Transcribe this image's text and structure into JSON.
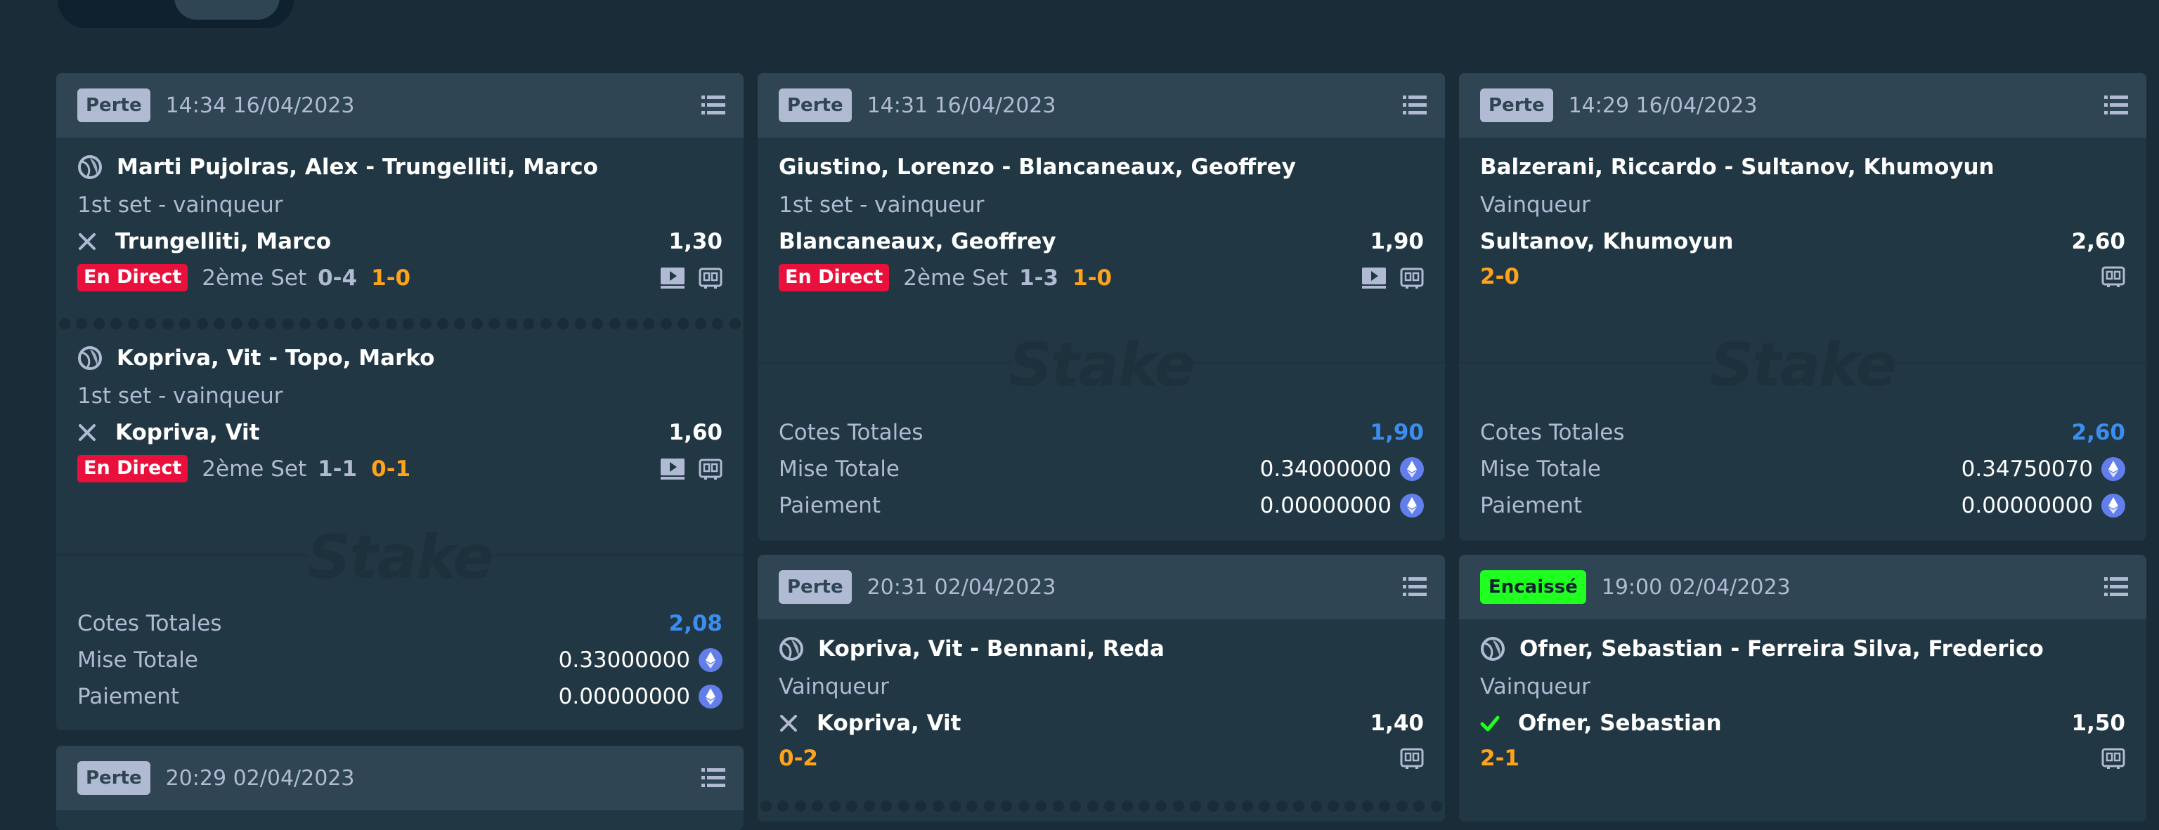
{
  "bets": [
    {
      "status": "Perte",
      "time": "14:34 16/04/2023",
      "legs": [
        {
          "match": "Marti Pujolras, Alex - Trungelliti, Marco",
          "market": "1st set - vainqueur",
          "selection": "Trungelliti, Marco",
          "odds": "1,30",
          "result_icon": "cross-icon",
          "live": "En Direct",
          "set": "2ème Set",
          "score_a": "0-4",
          "score_b": "1-0"
        },
        {
          "match": "Kopriva, Vit - Topo, Marko",
          "market": "1st set - vainqueur",
          "selection": "Kopriva, Vit",
          "odds": "1,60",
          "result_icon": "cross-icon",
          "live": "En Direct",
          "set": "2ème Set",
          "score_a": "1-1",
          "score_b": "0-1"
        }
      ],
      "watermark": "Stake",
      "totals": {
        "odds_label": "Cotes Totales",
        "odds": "2,08",
        "stake_label": "Mise Totale",
        "stake": "0.33000000",
        "payout_label": "Paiement",
        "payout": "0.00000000"
      }
    },
    {
      "status": "Perte",
      "time": "14:31 16/04/2023",
      "legs": [
        {
          "match": "Giustino, Lorenzo - Blancaneaux, Geoffrey",
          "market": "1st set - vainqueur",
          "selection": "Blancaneaux, Geoffrey",
          "odds": "1,90",
          "live": "En Direct",
          "set": "2ème Set",
          "score_a": "1-3",
          "score_b": "1-0"
        }
      ],
      "watermark": "Stake",
      "totals": {
        "odds_label": "Cotes Totales",
        "odds": "1,90",
        "stake_label": "Mise Totale",
        "stake": "0.34000000",
        "payout_label": "Paiement",
        "payout": "0.00000000"
      }
    },
    {
      "status": "Perte",
      "time": "14:29 16/04/2023",
      "legs": [
        {
          "match": "Balzerani, Riccardo - Sultanov, Khumoyun",
          "market": "Vainqueur",
          "selection": "Sultanov, Khumoyun",
          "odds": "2,60",
          "score_b": "2-0"
        }
      ],
      "watermark": "Stake",
      "totals": {
        "odds_label": "Cotes Totales",
        "odds": "2,60",
        "stake_label": "Mise Totale",
        "stake": "0.34750070",
        "payout_label": "Paiement",
        "payout": "0.00000000"
      }
    },
    {
      "status": "Perte",
      "time": "20:31 02/04/2023",
      "legs": [
        {
          "match": "Kopriva, Vit - Bennani, Reda",
          "market": "Vainqueur",
          "selection": "Kopriva, Vit",
          "odds": "1,40",
          "result_icon": "cross-icon",
          "score_b": "0-2"
        }
      ]
    },
    {
      "status": "Encaissé",
      "time": "19:00 02/04/2023",
      "legs": [
        {
          "match": "Ofner, Sebastian - Ferreira Silva, Frederico",
          "market": "Vainqueur",
          "selection": "Ofner, Sebastian",
          "odds": "1,50",
          "result_icon": "check-icon",
          "score_b": "2-1"
        }
      ]
    },
    {
      "status": "Perte",
      "time": "20:29 02/04/2023"
    }
  ],
  "colors": {
    "background": "#1a2c38",
    "card": "#213743",
    "header": "#2f4553",
    "live": "#e9113c",
    "score": "#ffa31a",
    "odds_total": "#3b8ef0",
    "won": "#1fff20"
  }
}
